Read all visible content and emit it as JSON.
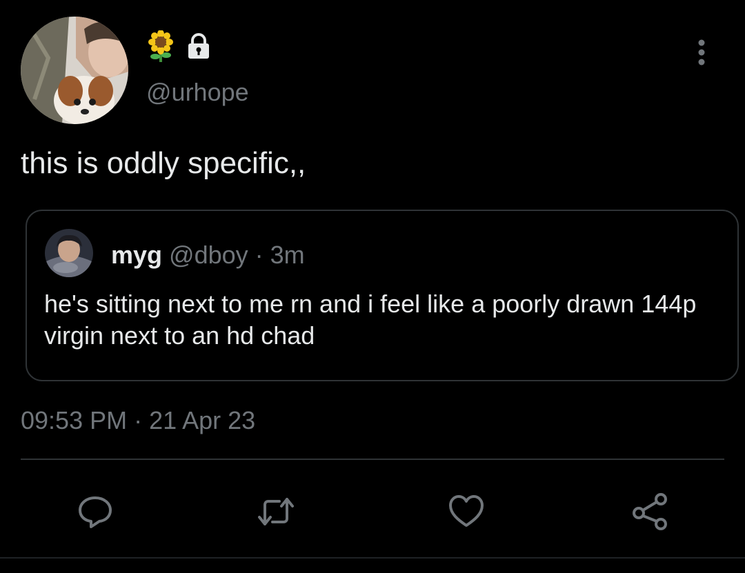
{
  "author": {
    "display_icons": [
      "sunflower-emoji",
      "lock-icon"
    ],
    "handle": "@urhope"
  },
  "tweet": {
    "text": "this is oddly specific,,",
    "timestamp": "09:53 PM · 21 Apr 23"
  },
  "quoted_tweet": {
    "name": "myg",
    "handle": "@dboy",
    "age": " · 3m",
    "text": "he's sitting next to me rn and i feel like a poorly drawn 144p virgin next to an hd chad"
  },
  "actions": [
    "reply-icon",
    "retweet-icon",
    "like-icon",
    "share-icon"
  ],
  "colors": {
    "background": "#000000",
    "text": "#e7e9ea",
    "muted": "#71767b",
    "border": "#2f3336"
  }
}
